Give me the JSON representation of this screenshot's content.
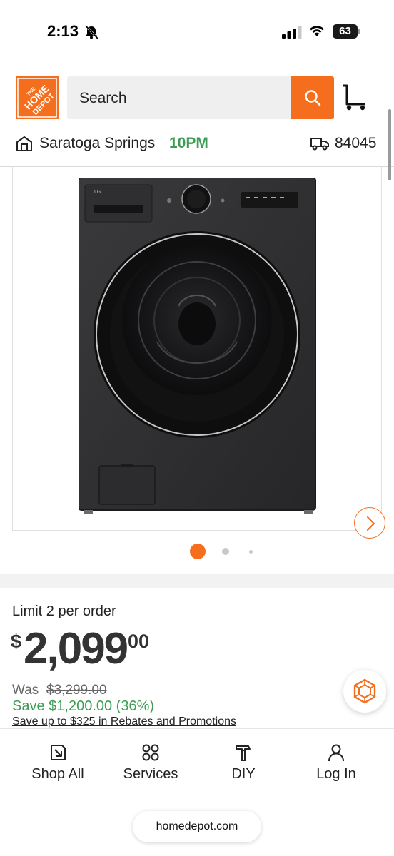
{
  "status_bar": {
    "time": "2:13",
    "battery": "63"
  },
  "header": {
    "logo_text": "THE HOME DEPOT",
    "search": {
      "placeholder": "Search"
    }
  },
  "location": {
    "store_name": "Saratoga Springs",
    "store_hours": "10PM",
    "zip": "84045"
  },
  "product_image": {
    "brand_mark": "LG",
    "carousel": {
      "total_slides": 3,
      "active_slide": 1
    }
  },
  "pricing": {
    "limit": "Limit 2 per order",
    "price_dollar_sign": "$",
    "price_main": "2,099",
    "price_cents": "00",
    "was_label": "Was",
    "was_price": "$3,299.00",
    "save": "Save $1,200.00 (36%)",
    "rebates": "Save up to $325 in Rebates and Promotions"
  },
  "bottom_nav": {
    "items": [
      {
        "label": "Shop All",
        "icon": "catalog-icon"
      },
      {
        "label": "Services",
        "icon": "services-icon"
      },
      {
        "label": "DIY",
        "icon": "hammer-icon"
      },
      {
        "label": "Log In",
        "icon": "person-icon"
      }
    ]
  },
  "browser": {
    "url": "homedepot.com"
  },
  "colors": {
    "brand_orange": "#f46e1e",
    "store_hours_green": "#3e9d54",
    "save_green": "#3e9d54"
  }
}
